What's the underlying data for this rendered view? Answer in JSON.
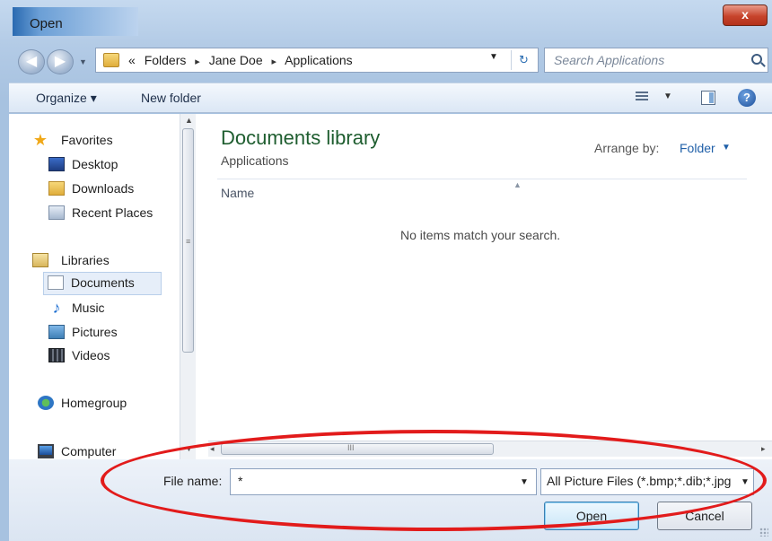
{
  "window": {
    "title": "Open",
    "close_glyph": "x"
  },
  "address": {
    "back_glyph": "◀",
    "forward_glyph": "▶",
    "recent_glyph": "▼",
    "overflow": "«",
    "crumbs": [
      "Folders",
      "Jane Doe",
      "Applications"
    ],
    "separator": "▸",
    "dropdown_glyph": "▼",
    "refresh_glyph": "↻"
  },
  "search": {
    "placeholder": "Search Applications"
  },
  "toolbar": {
    "organize_label": "Organize ▾",
    "new_folder_label": "New folder",
    "views_drop": "▼",
    "help_glyph": "?"
  },
  "nav": {
    "items": [
      {
        "label": "Favorites",
        "icon": "star-icon"
      },
      {
        "label": "Desktop",
        "icon": "desktop-icon"
      },
      {
        "label": "Downloads",
        "icon": "downloads-folder-icon"
      },
      {
        "label": "Recent Places",
        "icon": "recent-places-icon"
      },
      {
        "label": "Libraries",
        "icon": "libraries-icon"
      },
      {
        "label": "Documents",
        "icon": "document-icon",
        "selected": true
      },
      {
        "label": "Music",
        "icon": "music-note-icon"
      },
      {
        "label": "Pictures",
        "icon": "pictures-icon"
      },
      {
        "label": "Videos",
        "icon": "film-icon"
      },
      {
        "label": "Homegroup",
        "icon": "homegroup-icon"
      },
      {
        "label": "Computer",
        "icon": "computer-icon"
      }
    ],
    "scroll_up": "▲",
    "scroll_down": "▼",
    "scroll_grip": "≡"
  },
  "main": {
    "library_title": "Documents library",
    "library_subtitle": "Applications",
    "arrange_label": "Arrange by:",
    "arrange_value": "Folder",
    "arrange_drop": "▼",
    "column_name": "Name",
    "sort_arrow": "▲",
    "empty_message": "No items match your search."
  },
  "hscroll": {
    "left": "◂",
    "right": "▸",
    "grip": "III"
  },
  "bottom": {
    "file_name_label": "File name:",
    "file_name_value": "*",
    "file_name_drop": "▼",
    "file_type_value": "All Picture Files (*.bmp;*.dib;*.jpg",
    "file_type_drop": "▼",
    "open_label": "Open",
    "cancel_label": "Cancel"
  },
  "colors": {
    "accent_green": "#1e5d2f",
    "link_blue": "#1f5fa8",
    "annotation_red": "#e21b1b",
    "close_red": "#c7442c"
  }
}
